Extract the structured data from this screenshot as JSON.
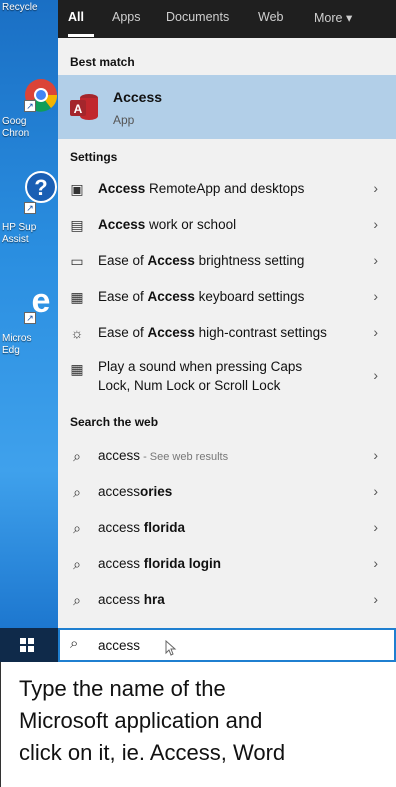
{
  "desktop": {
    "icons": [
      {
        "label": "Recycle"
      },
      {
        "label1": "Goog",
        "label2": "Chron"
      },
      {
        "label1": "HP Sup",
        "label2": "Assist"
      },
      {
        "label1": "Micros",
        "label2": "Edg"
      }
    ]
  },
  "tabs": [
    "All",
    "Apps",
    "Documents",
    "Web",
    "More"
  ],
  "best_match": {
    "header": "Best match",
    "title": "Access",
    "subtitle": "App"
  },
  "settings": {
    "header": "Settings",
    "items": [
      {
        "bold": "Access",
        "rest": " RemoteApp and desktops"
      },
      {
        "bold": "Access",
        "rest": " work or school"
      },
      {
        "pre": "Ease of ",
        "bold": "Access",
        "rest": " brightness setting"
      },
      {
        "pre": "Ease of ",
        "bold": "Access",
        "rest": " keyboard settings"
      },
      {
        "pre": "Ease of ",
        "bold": "Access",
        "rest": " high-contrast settings"
      },
      {
        "line1": "Play a sound when pressing Caps",
        "line2": "Lock, Num Lock or Scroll Lock"
      }
    ]
  },
  "web": {
    "header": "Search the web",
    "items": [
      {
        "pre": "access",
        "suffix": " - See web results"
      },
      {
        "pre": "access",
        "bold": "ories"
      },
      {
        "pre": "access ",
        "bold": "florida"
      },
      {
        "pre": "access ",
        "bold": "florida login"
      },
      {
        "pre": "access ",
        "bold": "hra"
      }
    ]
  },
  "search": {
    "value": "access"
  },
  "caption": {
    "line1": "Type the name of the",
    "line2": "Microsoft application and",
    "line3": "click on it, ie. Access, Word"
  },
  "colors": {
    "selected": "#b2cfe8",
    "tabbar": "#1f1f1f",
    "access_red": "#c1272d"
  }
}
